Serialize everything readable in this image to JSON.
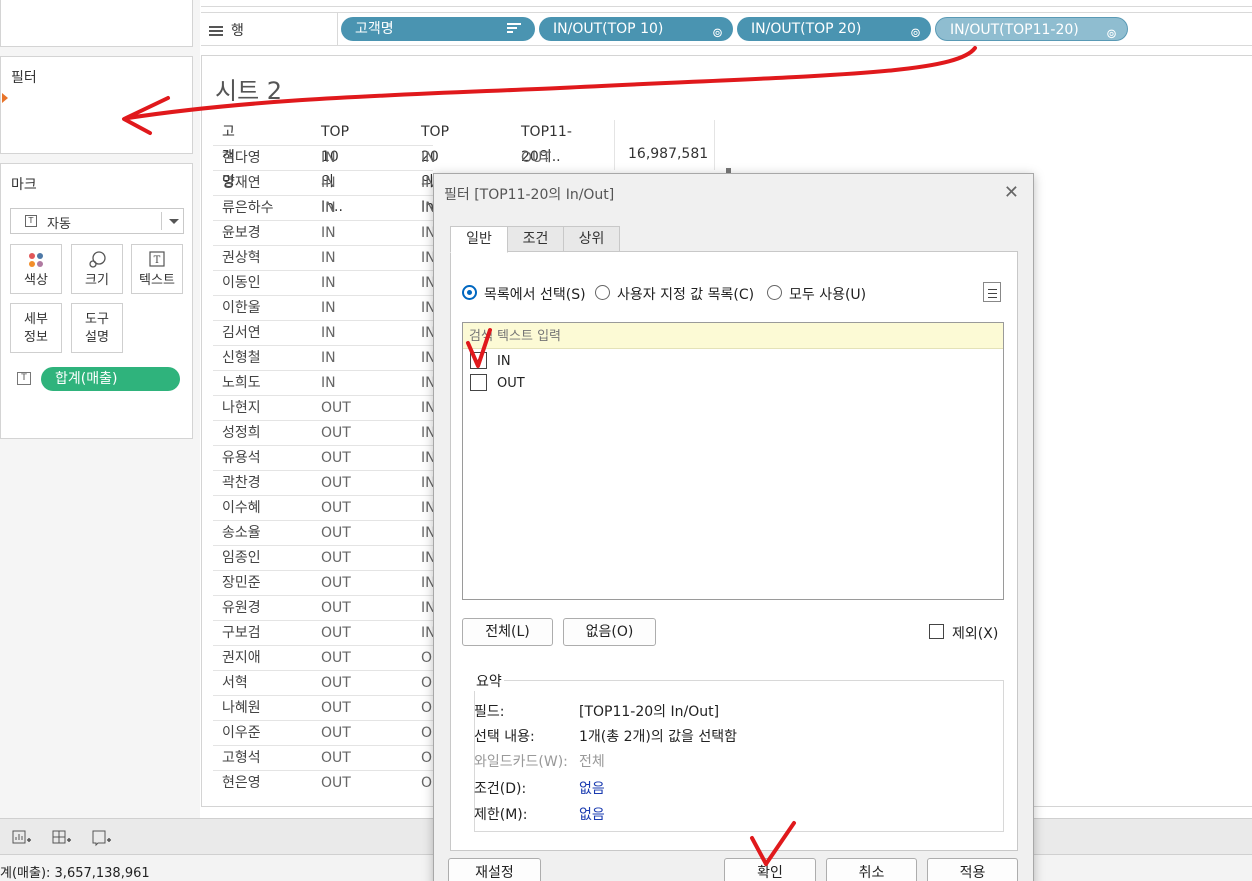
{
  "shelf": {
    "rows_label": "행",
    "pills": [
      "고객명",
      "IN/OUT(TOP 10)",
      "IN/OUT(TOP 20)",
      "IN/OUT(TOP11-20)"
    ]
  },
  "filters_pane": {
    "title": "필터"
  },
  "marks_pane": {
    "title": "마크",
    "type": "자동",
    "buttons": {
      "color": "색상",
      "size": "크기",
      "text": "텍스트",
      "detail_1": "세부",
      "detail_2": "정보",
      "tooltip_1": "도구",
      "tooltip_2": "설명"
    },
    "measure_pill": "합계(매출)"
  },
  "sheet": {
    "title": "시트 2",
    "headers": [
      "고객명",
      "TOP 10의 In..",
      "TOP 20의 In..",
      "TOP11-20의.."
    ],
    "first_total": "16,987,581",
    "rows": [
      {
        "name": "현다영",
        "top10": "IN",
        "top20": "IN",
        "top11_20": "OUT"
      },
      {
        "name": "양재연",
        "top10": "IN",
        "top20": "IN"
      },
      {
        "name": "류은하수",
        "top10": "IN",
        "top20": "IN"
      },
      {
        "name": "윤보경",
        "top10": "IN",
        "top20": "IN"
      },
      {
        "name": "권상혁",
        "top10": "IN",
        "top20": "IN"
      },
      {
        "name": "이동인",
        "top10": "IN",
        "top20": "IN"
      },
      {
        "name": "이한울",
        "top10": "IN",
        "top20": "IN"
      },
      {
        "name": "김서연",
        "top10": "IN",
        "top20": "IN"
      },
      {
        "name": "신형철",
        "top10": "IN",
        "top20": "IN"
      },
      {
        "name": "노희도",
        "top10": "IN",
        "top20": "IN"
      },
      {
        "name": "나현지",
        "top10": "OUT",
        "top20": "IN"
      },
      {
        "name": "성정희",
        "top10": "OUT",
        "top20": "IN"
      },
      {
        "name": "유용석",
        "top10": "OUT",
        "top20": "IN"
      },
      {
        "name": "곽찬경",
        "top10": "OUT",
        "top20": "IN"
      },
      {
        "name": "이수혜",
        "top10": "OUT",
        "top20": "IN"
      },
      {
        "name": "송소율",
        "top10": "OUT",
        "top20": "IN"
      },
      {
        "name": "임종인",
        "top10": "OUT",
        "top20": "IN"
      },
      {
        "name": "장민준",
        "top10": "OUT",
        "top20": "IN"
      },
      {
        "name": "유원경",
        "top10": "OUT",
        "top20": "IN"
      },
      {
        "name": "구보검",
        "top10": "OUT",
        "top20": "IN"
      },
      {
        "name": "권지애",
        "top10": "OUT",
        "top20": "O"
      },
      {
        "name": "서혁",
        "top10": "OUT",
        "top20": "O"
      },
      {
        "name": "나혜원",
        "top10": "OUT",
        "top20": "O"
      },
      {
        "name": "이우준",
        "top10": "OUT",
        "top20": "O"
      },
      {
        "name": "고형석",
        "top10": "OUT",
        "top20": "O"
      },
      {
        "name": "현은영",
        "top10": "OUT",
        "top20": "O"
      }
    ]
  },
  "status_bar": {
    "sum_text": "계(매출): 3,657,138,961"
  },
  "dialog": {
    "title": "필터 [TOP11-20의 In/Out]",
    "tabs": [
      "일반",
      "조건",
      "상위"
    ],
    "radios": [
      "목록에서 선택(S)",
      "사용자 지정 값 목록(C)",
      "모두 사용(U)"
    ],
    "search_placeholder": "검색 텍스트 입력",
    "items": [
      {
        "label": "IN",
        "checked": true
      },
      {
        "label": "OUT",
        "checked": false
      }
    ],
    "all_button": "전체(L)",
    "none_button": "없음(O)",
    "exclude_label": "제외(X)",
    "summary": {
      "title": "요약",
      "field_k": "필드:",
      "field_v": "[TOP11-20의 In/Out]",
      "selection_k": "선택 내용:",
      "selection_v": "1개(총 2개)의 값을 선택함",
      "wildcard_k": "와일드카드(W):",
      "wildcard_v": "전체",
      "condition_k": "조건(D):",
      "condition_v": "없음",
      "limit_k": "제한(M):",
      "limit_v": "없음"
    },
    "buttons": {
      "reset": "재설정",
      "ok": "확인",
      "cancel": "취소",
      "apply": "적용"
    }
  },
  "colors": {
    "pill_blue": "#4a94b1",
    "measure_green": "#2fb37c",
    "annotation_red": "#e0191c",
    "radio_blue": "#0067c0"
  }
}
